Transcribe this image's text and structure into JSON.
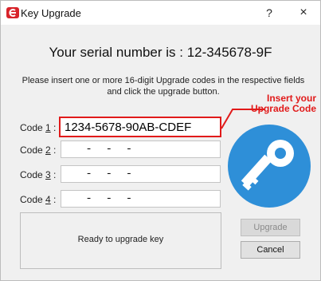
{
  "window": {
    "title": "Key Upgrade",
    "help_label": "?",
    "close_label": "×"
  },
  "serial": {
    "text": "Your serial number is : 12-345678-9F"
  },
  "instructions": {
    "line1": "Please insert one or more 16-digit Upgrade codes in the respective fields",
    "line2": "and click the upgrade button."
  },
  "codes": [
    {
      "label_prefix": "Code ",
      "label_key": "1",
      "label_suffix": " :",
      "value": "1234-5678-90AB-CDEF",
      "placeholder": ""
    },
    {
      "label_prefix": "Code ",
      "label_key": "2",
      "label_suffix": " :",
      "value": "",
      "placeholder": " -  -  - "
    },
    {
      "label_prefix": "Code ",
      "label_key": "3",
      "label_suffix": " :",
      "value": "",
      "placeholder": " -  -  - "
    },
    {
      "label_prefix": "Code ",
      "label_key": "4",
      "label_suffix": " :",
      "value": "",
      "placeholder": " -  -  - "
    }
  ],
  "annotation": {
    "line1": "Insert your",
    "line2": "Upgrade Code"
  },
  "status": {
    "text": "Ready to upgrade key"
  },
  "buttons": {
    "upgrade": "Upgrade",
    "cancel": "Cancel"
  },
  "colors": {
    "accent_red": "#e11a1a",
    "key_blue": "#2e8fd8"
  },
  "icons": {
    "app": "app-logo-icon",
    "key": "key-icon"
  }
}
